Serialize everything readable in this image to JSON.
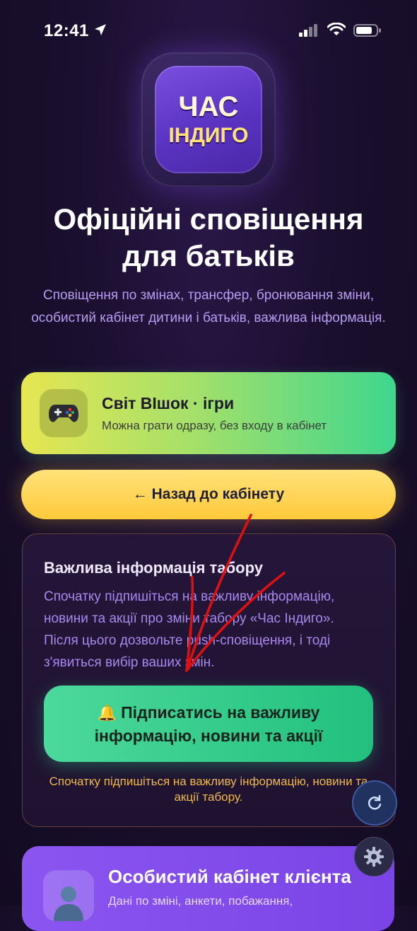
{
  "status_bar": {
    "time": "12:41"
  },
  "logo": {
    "line1": "ЧАС",
    "line2": "ІНДИГО"
  },
  "header": {
    "title_line1": "Офіційні сповіщення",
    "title_line2": "для батьків",
    "subtitle": "Сповіщення по змінах, трансфер, бронювання зміни, особистий кабінет дитини і батьків, важлива інформація."
  },
  "game_card": {
    "icon": "gamepad-icon",
    "title": "Світ ВІшок · ігри",
    "subtitle": "Можна грати одразу, без входу в кабінет"
  },
  "back_button": {
    "label": "← Назад до кабінету"
  },
  "info_card": {
    "title": "Важлива інформація табору",
    "text": "Спочатку підпишіться на важливу інформацію, новини та акції про зміни табору «Час Індиго». Після цього дозвольте push-сповіщення, і тоді з'явиться вибір ваших змін.",
    "subscribe_button": "Підписатись на важливу інформацію, новини та акції",
    "hint": "Спочатку підпишіться на важливу інформацію, новини та акції табору."
  },
  "cabinet_card": {
    "title": "Особистий кабінет клієнта",
    "subtitle": "Дані по зміні, анкети, побажання,"
  },
  "colors": {
    "background": "#1a0f2e",
    "accent_purple": "#7a4fe0",
    "back_button_yellow": "#ffc93a",
    "subscribe_green": "#22c07e",
    "annotation_red": "#e01010"
  }
}
